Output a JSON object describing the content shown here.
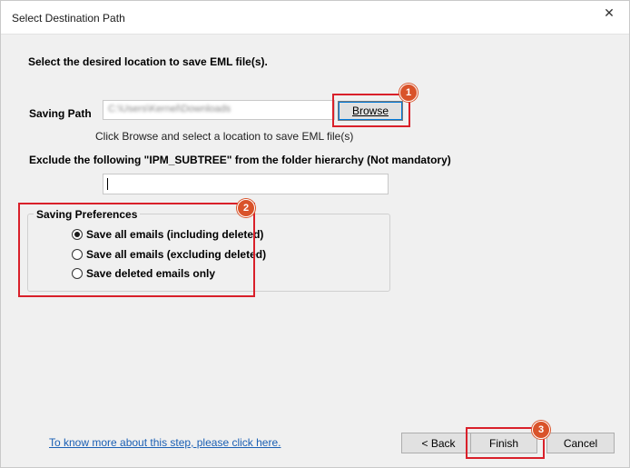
{
  "window": {
    "title": "Select Destination Path",
    "close_glyph": "✕"
  },
  "heading": "Select the desired location to save EML file(s).",
  "saving_path": {
    "label": "Saving Path",
    "value": "C:\\Users\\Kernel\\Downloads",
    "browse_label": "Browse",
    "hint": "Click Browse and select a location to save EML file(s)"
  },
  "exclude": {
    "label": "Exclude the following \"IPM_SUBTREE\" from the folder hierarchy (Not mandatory)",
    "value": ""
  },
  "preferences": {
    "legend": "Saving Preferences",
    "options": [
      {
        "label": "Save all emails (including deleted)",
        "selected": true
      },
      {
        "label": "Save all emails (excluding deleted)",
        "selected": false
      },
      {
        "label": "Save deleted emails only",
        "selected": false
      }
    ]
  },
  "help_link": "To know more about this step, please click here.",
  "buttons": {
    "back": "< Back",
    "finish": "Finish",
    "cancel": "Cancel"
  },
  "annotations": {
    "badge1": "1",
    "badge2": "2",
    "badge3": "3",
    "highlight_color": "#d9202a",
    "badge_color": "#d9532a"
  }
}
